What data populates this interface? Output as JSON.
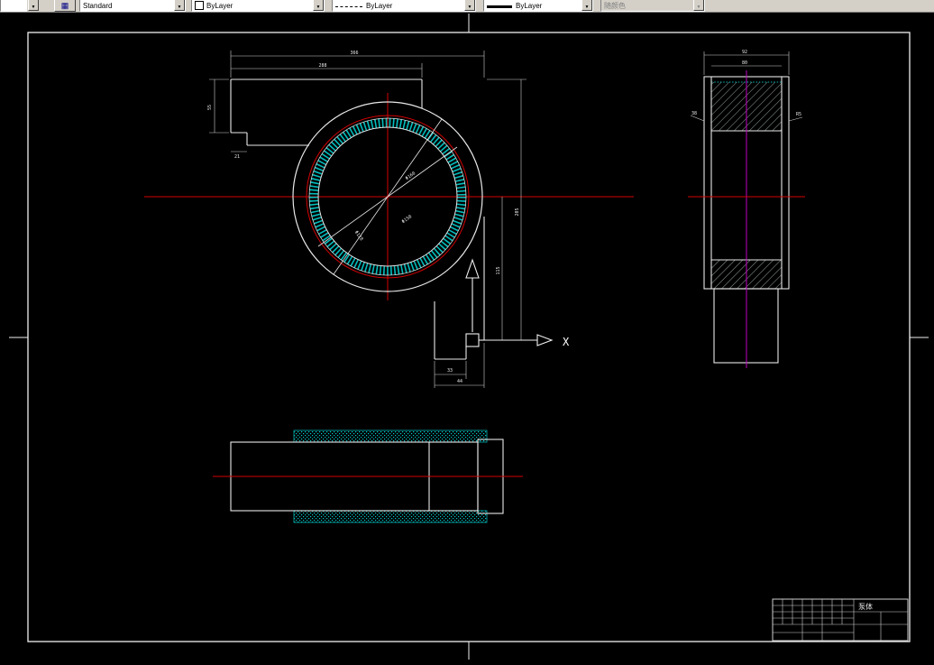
{
  "toolbar": {
    "style_combo": {
      "value": "Standard"
    },
    "color_combo": {
      "value": "ByLayer"
    },
    "linetype_combo": {
      "value": "ByLayer"
    },
    "lineweight_combo": {
      "value": "ByLayer"
    },
    "plot_style_combo": {
      "value": "随颜色"
    }
  },
  "drawing": {
    "ucs": {
      "x_label": "X"
    },
    "front_view": {
      "dim_total_width": "366",
      "dim_flange_width": "288",
      "dim_flange_height": "55",
      "dim_step": "21",
      "dim_right_inner": "115",
      "dim_right_total": "205",
      "dim_notch_width": "33",
      "dim_notch_total": "44",
      "dim_dia_outer": "Φ160",
      "dim_dia_mid": "Φ150",
      "dim_dia_bore": "Φ128"
    },
    "side_view": {
      "dim_total_width": "92",
      "dim_bore_width": "80",
      "dim_left": "38",
      "dim_right": "R5"
    },
    "title_block": {
      "part_name": "泵体"
    }
  }
}
